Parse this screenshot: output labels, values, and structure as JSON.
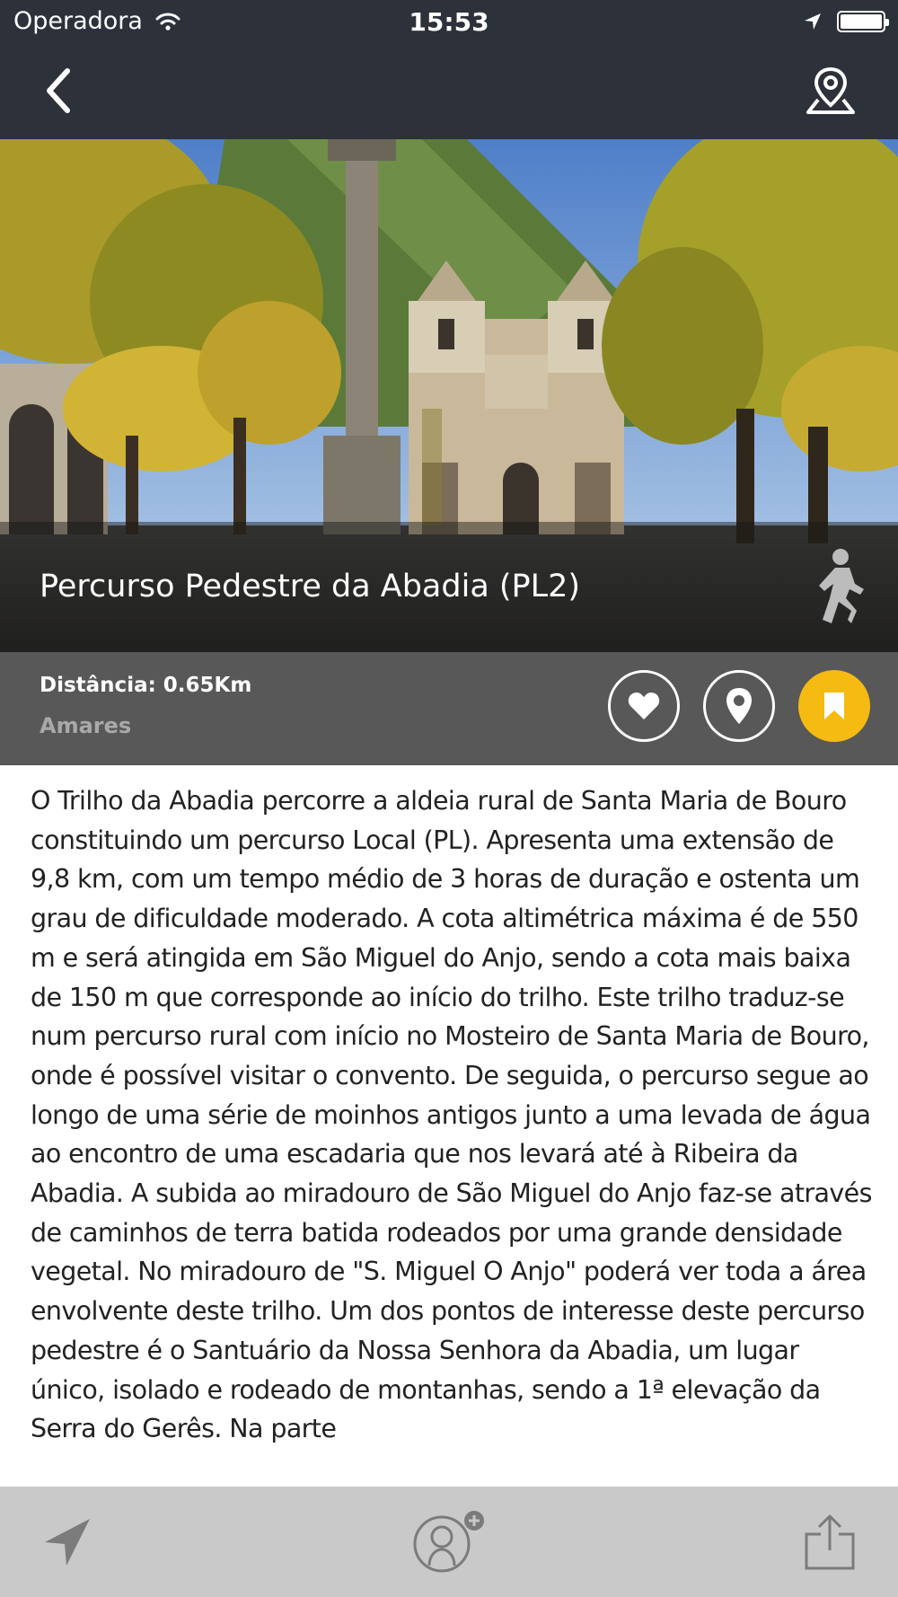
{
  "status_bar": {
    "carrier": "Operadora",
    "time": "15:53",
    "battery_level": 1.0
  },
  "nav": {
    "back_icon": "chevron-left-icon",
    "map_icon": "map-pin-icon"
  },
  "hero": {
    "title": "Percurso Pedestre da Abadia (PL2)",
    "activity_icon": "walker-icon"
  },
  "info": {
    "distance": "Distância: 0.65Km",
    "location": "Amares",
    "actions": [
      "heart-icon",
      "location-pin-icon",
      "bookmark-icon"
    ],
    "bookmark_color": "#f6bb12"
  },
  "description": "O Trilho da Abadia percorre a aldeia rural de Santa Maria de Bouro constituindo um percurso Local (PL). Apresenta uma extensão de 9,8 km, com um tempo médio de 3 horas de duração e ostenta um grau de dificuldade moderado. A cota altimétrica máxima é de 550 m e será atingida em São Miguel do Anjo, sendo a cota mais baixa de 150 m que corresponde ao início do trilho. Este trilho traduz-se num percurso rural com início no Mosteiro de Santa Maria de Bouro, onde é possível visitar o convento. De seguida, o percurso segue ao longo de uma série de moinhos antigos junto a uma levada de água ao encontro de uma escadaria que nos levará até à Ribeira da Abadia. A subida ao miradouro de São Miguel do Anjo faz-se através de caminhos de terra batida rodeados por uma grande densidade vegetal. No miradouro de \"S. Miguel O Anjo\" poderá ver toda a área envolvente deste trilho. Um dos pontos de interesse deste percurso pedestre é o Santuário da Nossa Senhora da Abadia, um lugar único, isolado e rodeado de montanhas, sendo a 1ª elevação da Serra do Gerês. Na parte",
  "toolbar": {
    "items": [
      "navigation-arrow-icon",
      "add-user-icon",
      "share-icon"
    ]
  },
  "colors": {
    "header_bg": "#2c313a",
    "info_bg": "#585858",
    "toolbar_bg": "#c9c9c9",
    "accent": "#f6bb12"
  }
}
